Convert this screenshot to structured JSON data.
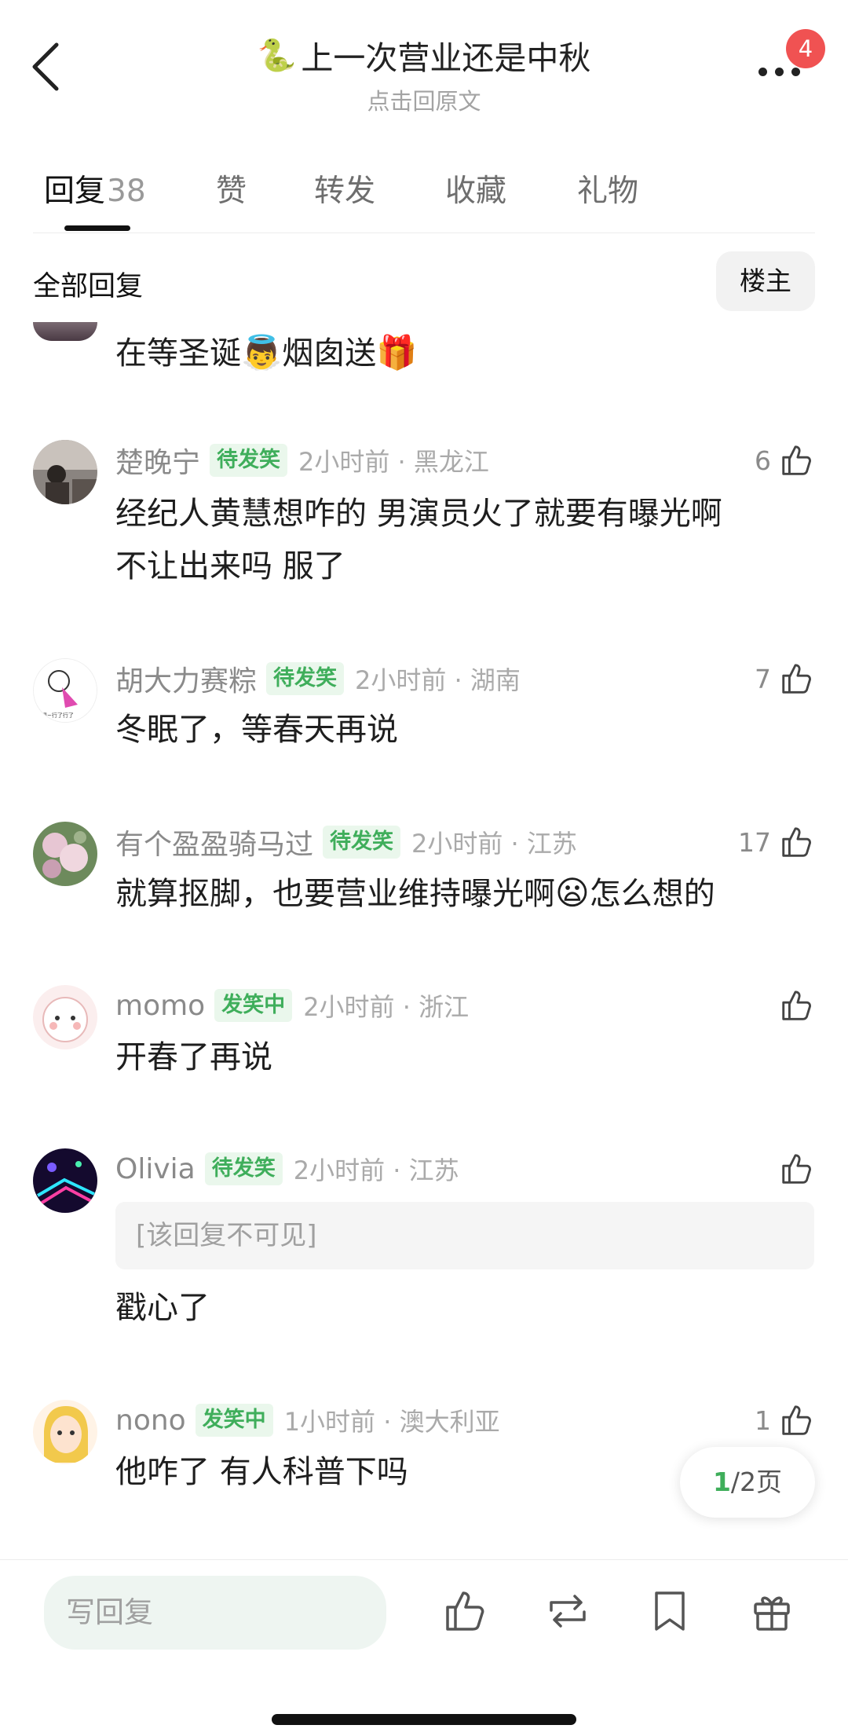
{
  "header": {
    "title_icon": "🐍",
    "title": "上一次营业还是中秋",
    "subtitle": "点击回原文",
    "badge_count": "4"
  },
  "tabs": [
    {
      "label": "回复",
      "count": "38",
      "active": true
    },
    {
      "label": "赞"
    },
    {
      "label": "转发"
    },
    {
      "label": "收藏"
    },
    {
      "label": "礼物"
    }
  ],
  "section": {
    "title": "全部回复",
    "owner_button": "楼主"
  },
  "comments": [
    {
      "text_parts": [
        "在等圣诞",
        "👼",
        "烟囱送",
        "🎁"
      ]
    },
    {
      "username": "楚晚宁",
      "tag": "待发笑",
      "time": "2小时前 · 黑龙江",
      "likes": "6",
      "text_lines": [
        "经纪人黄慧想咋的 男演员火了就要有曝光啊",
        "不让出来吗 服了"
      ]
    },
    {
      "username": "胡大力赛粽",
      "tag": "待发笑",
      "time": "2小时前 · 湖南",
      "likes": "7",
      "avatar_text": "嗯~行了行了",
      "text": "冬眠了，等春天再说"
    },
    {
      "username": "有个盈盈骑马过",
      "tag": "待发笑",
      "time": "2小时前 · 江苏",
      "likes": "17",
      "text_parts": [
        "就算抠脚，也要营业维持曝光啊",
        "😦",
        "怎么想的"
      ]
    },
    {
      "username": "momo",
      "tag": "发笑中",
      "time": "2小时前 · 浙江",
      "likes": "",
      "text": "开春了再说"
    },
    {
      "username": "Olivia",
      "tag": "待发笑",
      "time": "2小时前 · 江苏",
      "likes": "",
      "quote": "[该回复不可见]",
      "text": "戳心了"
    },
    {
      "username": "nono",
      "tag": "发笑中",
      "time": "1小时前 · 澳大利亚",
      "likes": "1",
      "text": "他咋了 有人科普下吗"
    }
  ],
  "pagination": {
    "current": "1",
    "total": "/2页"
  },
  "bottom_bar": {
    "reply_placeholder": "写回复"
  },
  "icons": [
    "back-arrow-icon",
    "more-icon",
    "thumbs-up-icon",
    "repost-icon",
    "bookmark-icon",
    "gift-icon"
  ],
  "colors": {
    "accent_green": "#3fae5b",
    "tag_bg": "#eaf7ec",
    "badge_red": "#f05252"
  }
}
